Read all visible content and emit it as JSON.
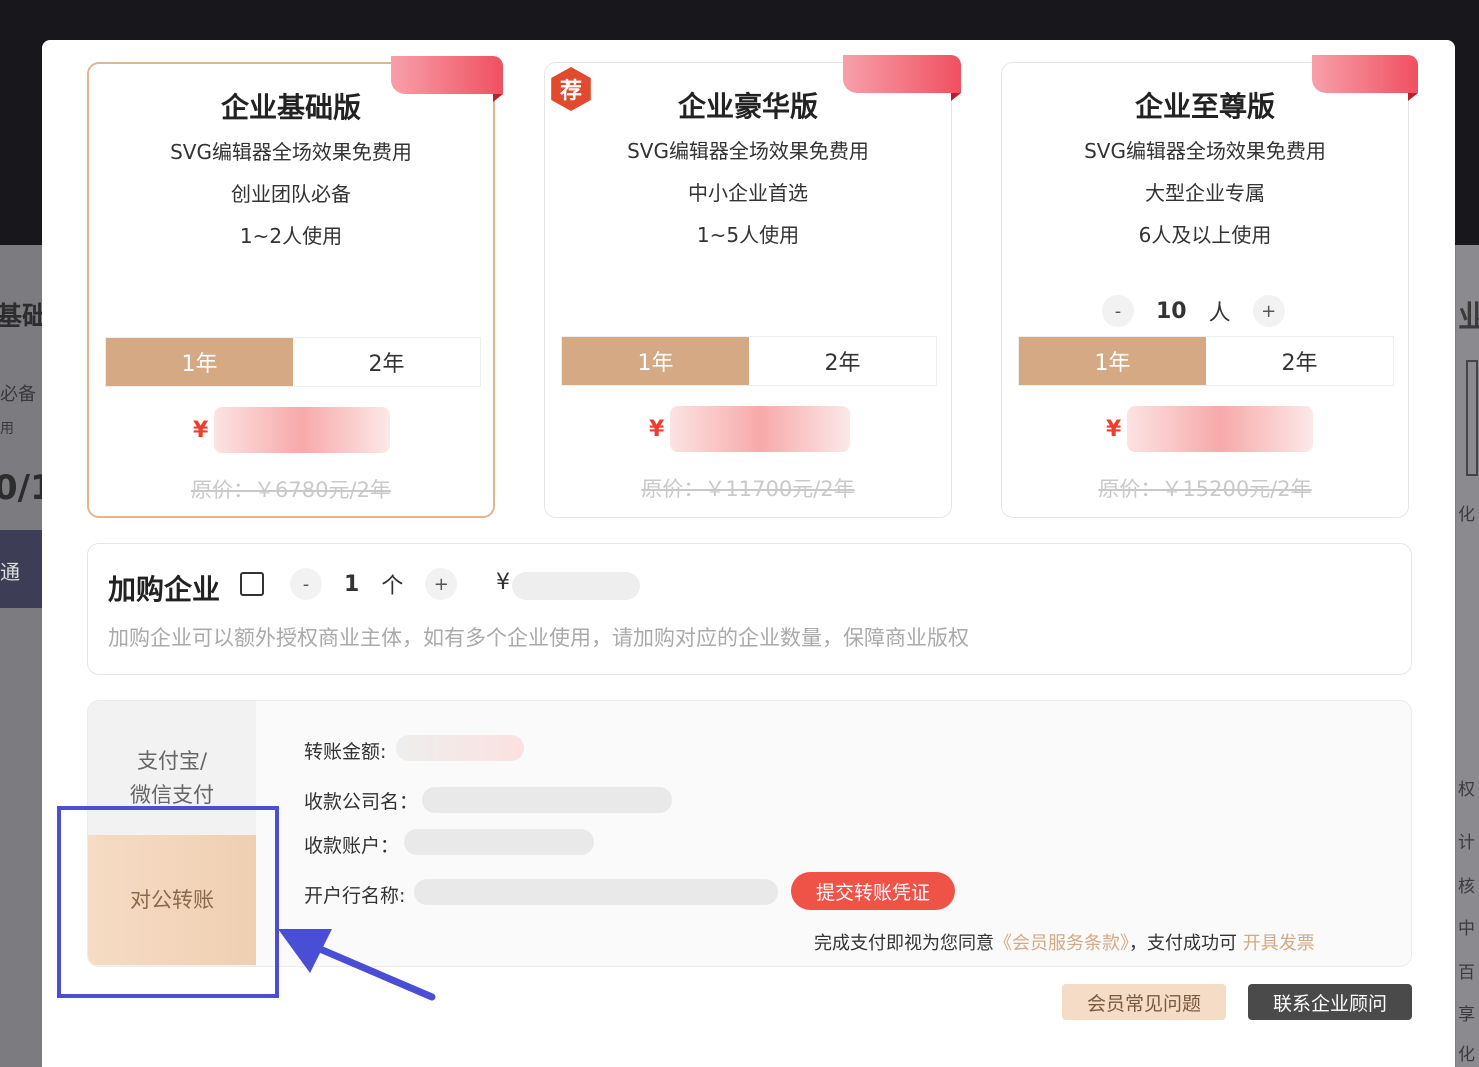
{
  "background": {
    "left_title": "基础",
    "left_sub": "必备",
    "left_sub2": "用",
    "left_price": "0/1",
    "left_button": "通",
    "right_big": "业",
    "right_items": [
      "化",
      "权",
      "计",
      "核",
      "中",
      "百",
      "享",
      "化"
    ]
  },
  "plans": [
    {
      "title": "企业基础版",
      "feature": "SVG编辑器全场效果免费用",
      "tagline": "创业团队必备",
      "users": "1~2人使用",
      "years": [
        "1年",
        "2年"
      ],
      "selected_year": "1年",
      "currency": "¥",
      "original_price": "原价：￥6780元/2年"
    },
    {
      "badge": "荐",
      "title": "企业豪华版",
      "feature": "SVG编辑器全场效果免费用",
      "tagline": "中小企业首选",
      "users": "1~5人使用",
      "years": [
        "1年",
        "2年"
      ],
      "selected_year": "1年",
      "currency": "¥",
      "original_price": "原价：￥11700元/2年"
    },
    {
      "title": "企业至尊版",
      "feature": "SVG编辑器全场效果免费用",
      "tagline": "大型企业专属",
      "users": "6人及以上使用",
      "stepper": {
        "minus": "-",
        "value": "10",
        "unit": "人",
        "plus": "+"
      },
      "years": [
        "1年",
        "2年"
      ],
      "selected_year": "1年",
      "currency": "¥",
      "original_price": "原价：￥15200元/2年"
    }
  ],
  "add_company": {
    "title": "加购企业",
    "minus": "-",
    "count": "1",
    "unit": "个",
    "plus": "+",
    "currency": "¥",
    "description": "加购企业可以额外授权商业主体，如有多个企业使用，请加购对应的企业数量，保障商业版权"
  },
  "payment": {
    "tabs": [
      "支付宝/\n微信支付",
      "对公转账"
    ],
    "active_tab": "对公转账",
    "fields": {
      "amount": "转账金额:",
      "company": "收款公司名：",
      "account": "收款账户：",
      "bank": "开户行名称:"
    },
    "submit": "提交转账凭证",
    "agree_prefix": "完成支付即视为您同意",
    "terms_link": "《会员服务条款》",
    "agree_mid": "，支付成功可",
    "invoice_link": "开具发票"
  },
  "footer": {
    "faq": "会员常见问题",
    "contact": "联系企业顾问"
  },
  "colors": {
    "accent_gold": "#d4a983",
    "price_red": "#f03c2e",
    "submit_red": "#ef5348",
    "annotation_blue": "#4a4ed4"
  }
}
